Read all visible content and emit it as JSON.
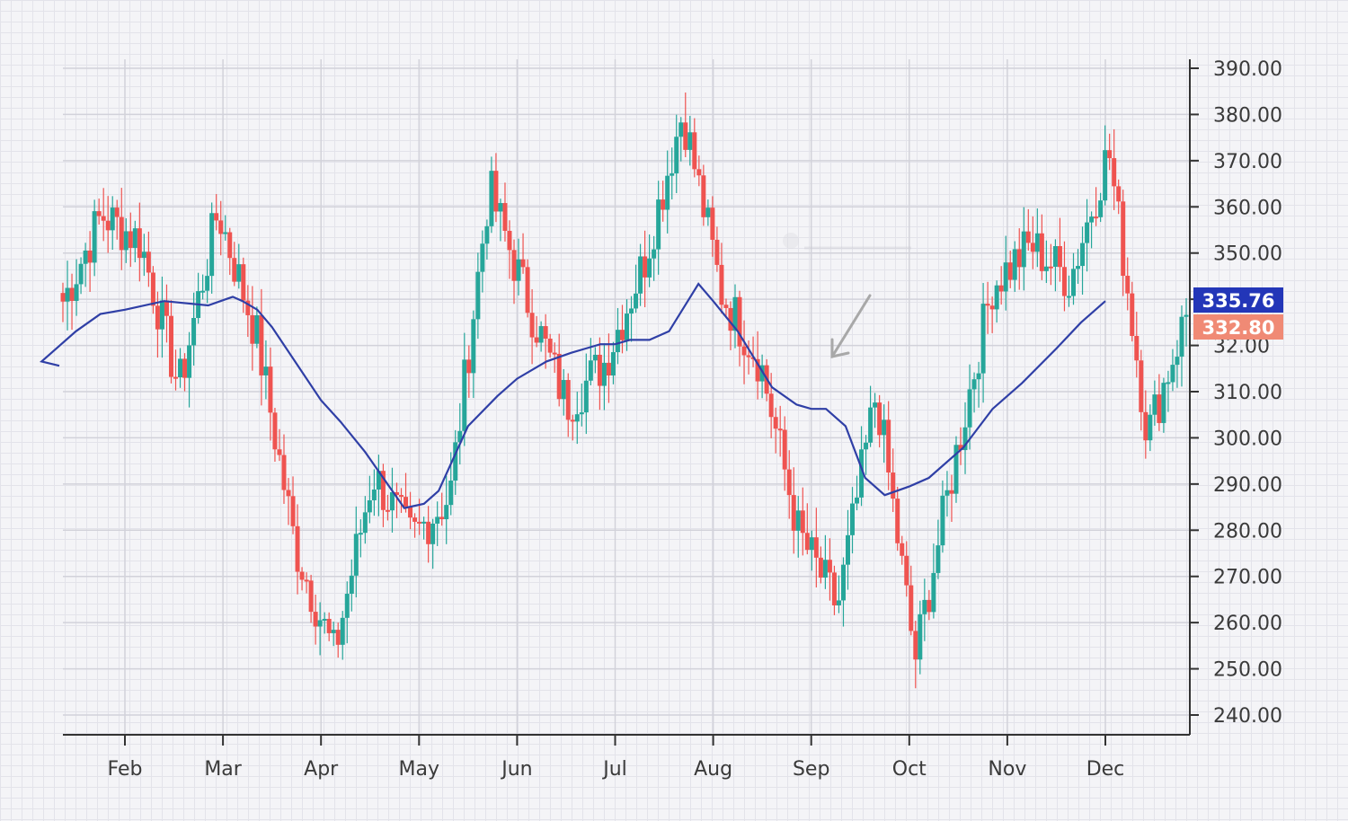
{
  "chart_data": {
    "type": "candlestick",
    "x_tick_labels": [
      "Feb",
      "Mar",
      "Apr",
      "May",
      "Jun",
      "Jul",
      "Aug",
      "Sep",
      "Oct",
      "Nov",
      "Dec"
    ],
    "y_tick_labels": [
      "390.00",
      "380.00",
      "370.00",
      "360.00",
      "350.00",
      "340.00",
      "32.00",
      "310.00",
      "300.00",
      "290.00",
      "280.00",
      "270.00",
      "260.00",
      "250.00",
      "240.00"
    ],
    "ylim": [
      237,
      391
    ],
    "grid": true,
    "legend": "none",
    "price_tags": {
      "moving_average": "335.76",
      "last_close": "332.80"
    },
    "colors": {
      "up": "#26a69a",
      "down": "#ef5350",
      "moving_average": "#2f3fa6",
      "tag_average_bg": "#2336b8",
      "tag_close_bg": "#f08a75",
      "arrow": "#a8a8a8"
    },
    "series": [
      {
        "type": "candlestick",
        "interval": "daily, Jan – Dec (approx. readings)",
        "anchors": [
          {
            "month": "Jan (start)",
            "close": 336
          },
          {
            "month": "late Jan",
            "close": 356
          },
          {
            "month": "early Feb",
            "close": 350
          },
          {
            "month": "mid Feb (low)",
            "close": 316
          },
          {
            "month": "late Feb (high)",
            "close": 357
          },
          {
            "month": "early Mar",
            "close": 328
          },
          {
            "month": "late Mar (low)",
            "close": 279
          },
          {
            "month": "Apr (low)",
            "close": 254
          },
          {
            "month": "early Apr",
            "close": 296
          },
          {
            "month": "mid May",
            "close": 281
          },
          {
            "month": "late May",
            "close": 291
          },
          {
            "month": "mid Jun (high)",
            "close": 362
          },
          {
            "month": "late Jun",
            "close": 336
          },
          {
            "month": "early Jul",
            "close": 312
          },
          {
            "month": "mid Jul",
            "close": 322
          },
          {
            "month": "early Aug",
            "close": 345
          },
          {
            "month": "Aug (high)",
            "close": 380
          },
          {
            "month": "mid Aug",
            "close": 338
          },
          {
            "month": "late Aug",
            "close": 322
          },
          {
            "month": "early Sep",
            "close": 282
          },
          {
            "month": "Sep (low)",
            "close": 265
          },
          {
            "month": "late Sep",
            "close": 315
          },
          {
            "month": "Oct (low)",
            "close": 253
          },
          {
            "month": "late Oct",
            "close": 298
          },
          {
            "month": "early Nov",
            "close": 340
          },
          {
            "month": "late Nov",
            "close": 349
          },
          {
            "month": "early Dec",
            "close": 341
          },
          {
            "month": "mid Dec (high)",
            "close": 371
          },
          {
            "month": "late Dec",
            "close": 305
          },
          {
            "month": "Dec (end)",
            "close": 332.8
          }
        ]
      },
      {
        "type": "line",
        "role": "moving average",
        "x_month_index": [
          0,
          0.15,
          0.5,
          0.75,
          1.0,
          1.4,
          1.85,
          2.1,
          2.2,
          2.35,
          2.5,
          3.0,
          3.2,
          3.45,
          3.85,
          4.05,
          4.2,
          4.5,
          4.8,
          5.0,
          5.3,
          5.55,
          5.7,
          5.85,
          6.0,
          6.15,
          6.35,
          6.55,
          6.85,
          7.0,
          7.25,
          7.6,
          7.85,
          8.0,
          8.15,
          8.35,
          8.55,
          8.75,
          9.0,
          9.2,
          9.55,
          9.65,
          9.85,
          10.15,
          10.5,
          10.75,
          11.0
        ],
        "y": [
          321,
          322,
          329,
          333,
          334,
          336,
          335,
          337,
          336,
          334,
          330,
          313,
          308,
          301,
          288,
          289,
          292,
          307,
          314,
          318,
          322,
          324,
          325,
          326,
          326,
          327,
          327,
          329,
          340,
          336,
          329,
          316,
          312,
          311,
          311,
          307,
          295,
          291,
          293,
          295,
          302,
          305,
          311,
          317,
          325,
          331,
          336
        ]
      }
    ]
  }
}
